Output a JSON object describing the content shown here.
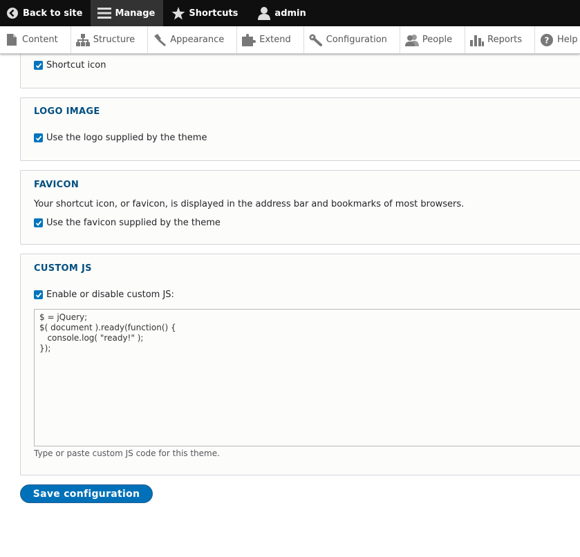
{
  "toolbar": {
    "back_label": "Back to site",
    "manage_label": "Manage",
    "shortcuts_label": "Shortcuts",
    "user_label": "admin"
  },
  "tray": {
    "items": [
      {
        "label": "Content",
        "icon": "document-icon"
      },
      {
        "label": "Structure",
        "icon": "structure-icon"
      },
      {
        "label": "Appearance",
        "icon": "paintbrush-icon"
      },
      {
        "label": "Extend",
        "icon": "puzzle-icon"
      },
      {
        "label": "Configuration",
        "icon": "wrench-icon"
      },
      {
        "label": "People",
        "icon": "people-icon"
      },
      {
        "label": "Reports",
        "icon": "bar-chart-icon"
      },
      {
        "label": "Help",
        "icon": "help-icon"
      }
    ]
  },
  "shortcut_section": {
    "checkbox_label": "Shortcut icon",
    "checked": true
  },
  "logo_section": {
    "title": "LOGO IMAGE",
    "checkbox_label": "Use the logo supplied by the theme",
    "checked": true
  },
  "favicon_section": {
    "title": "FAVICON",
    "description": "Your shortcut icon, or favicon, is displayed in the address bar and bookmarks of most browsers.",
    "checkbox_label": "Use the favicon supplied by the theme",
    "checked": true
  },
  "customjs_section": {
    "title": "CUSTOM JS",
    "checkbox_label": "Enable or disable custom JS:",
    "checked": true,
    "code": "$ = jQuery;\n$( document ).ready(function() {\n   console.log( \"ready!\" );\n});",
    "help": "Type or paste custom JS code for this theme."
  },
  "save_button_label": "Save configuration",
  "colors": {
    "accent": "#0071b8",
    "legend": "#004f80",
    "toolbar_bg": "#0f0f0f"
  }
}
